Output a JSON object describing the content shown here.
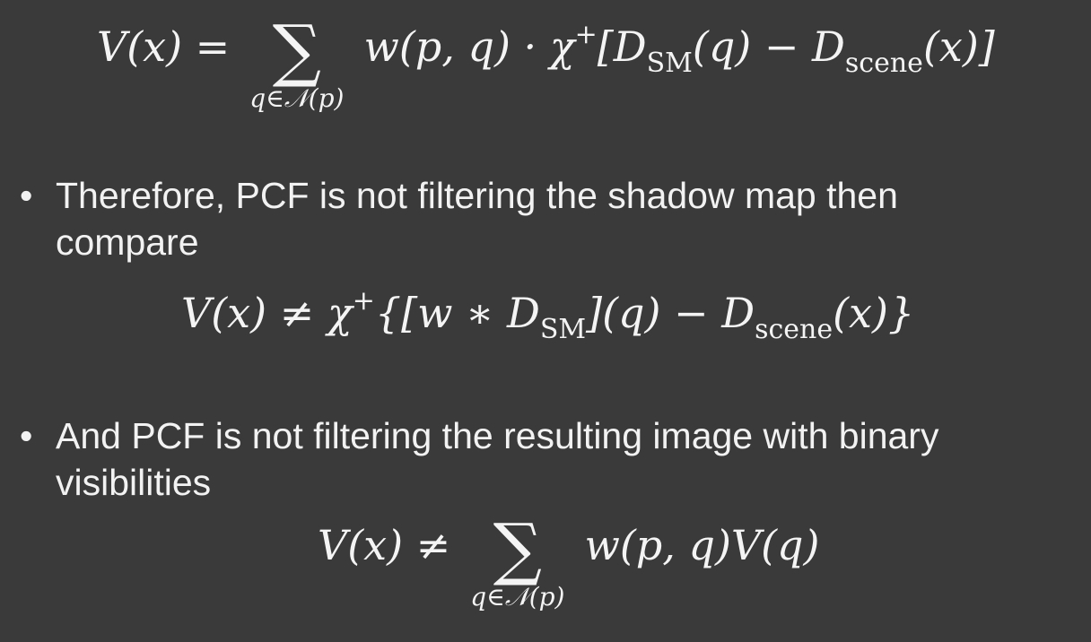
{
  "eq1": {
    "lhs": "V(x) =",
    "sum_symbol": "∑",
    "sum_index": "q∈𝒩(p)",
    "term": "w(p, q) · χ",
    "sup": "+",
    "bracket_open": "[D",
    "sub1": "SM",
    "mid": "(q) − D",
    "sub2": "scene",
    "end": "(x)]"
  },
  "bullets": [
    {
      "dot": "•",
      "line1": "Therefore, PCF is not filtering the shadow map then",
      "line2": "compare"
    },
    {
      "dot": "•",
      "line1": "And PCF is not filtering the resulting image with binary",
      "line2": "visibilities"
    }
  ],
  "eq2": {
    "lhs": "V(x) ≠ χ",
    "sup": "+",
    "open": "{[w ∗ D",
    "sub1": "SM",
    "mid": "](q) − D",
    "sub2": "scene",
    "end": "(x)}"
  },
  "eq3": {
    "lhs": "V(x) ≠",
    "sum_symbol": "∑",
    "sum_index": "q∈𝒩(p)",
    "term": "w(p, q)V(q)"
  }
}
